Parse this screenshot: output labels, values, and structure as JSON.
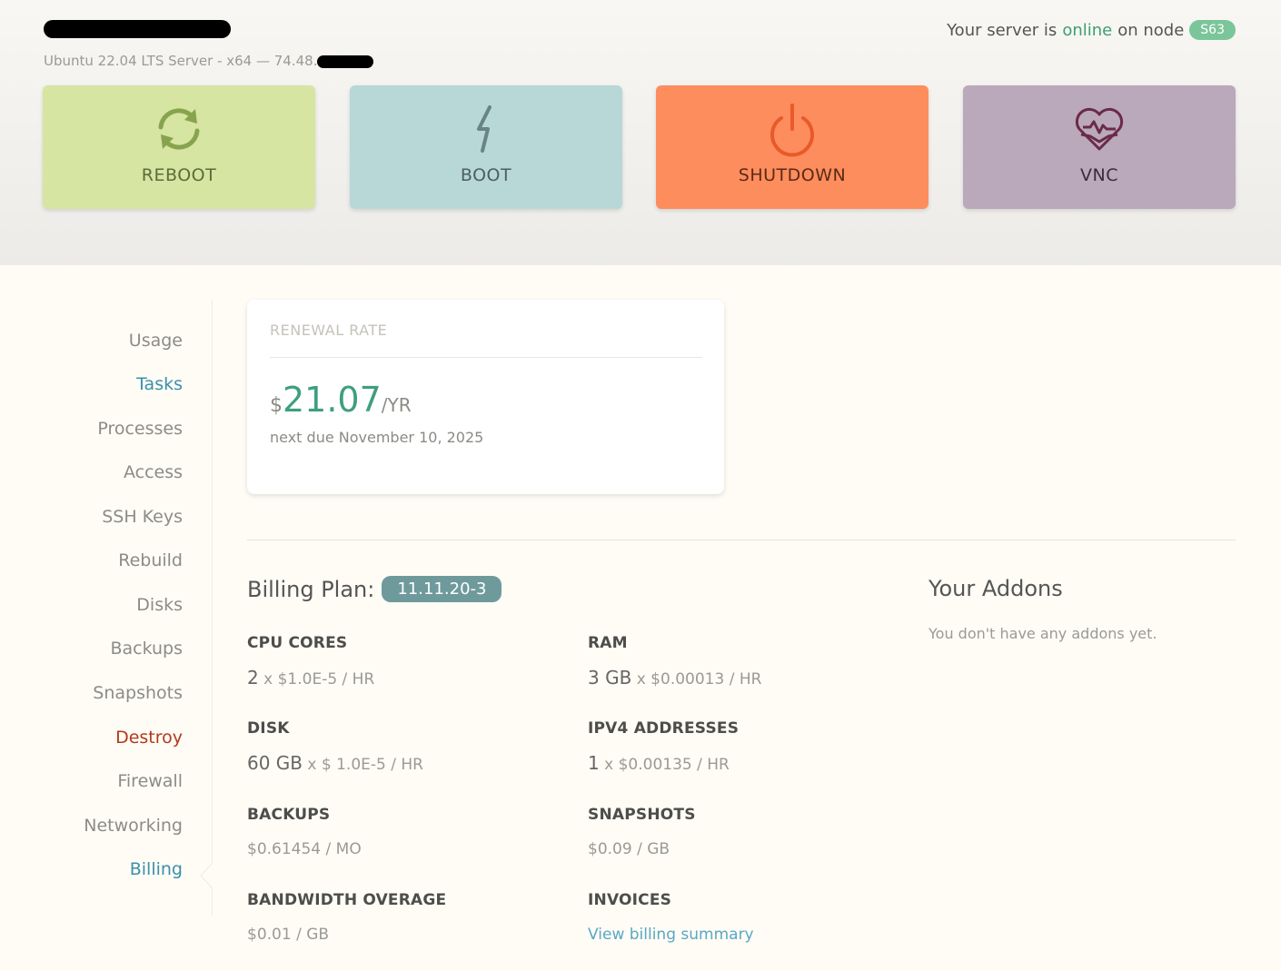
{
  "header": {
    "os_line": "Ubuntu 22.04 LTS Server - x64 — 74.48.",
    "status_prefix": "Your server is",
    "status_state": "online",
    "status_suffix": "on node",
    "node": "S63"
  },
  "actions": {
    "reboot": "REBOOT",
    "boot": "BOOT",
    "shutdown": "SHUTDOWN",
    "vnc": "VNC"
  },
  "sidebar": {
    "items": [
      "Usage",
      "Tasks",
      "Processes",
      "Access",
      "SSH Keys",
      "Rebuild",
      "Disks",
      "Backups",
      "Snapshots",
      "Destroy",
      "Firewall",
      "Networking",
      "Billing"
    ]
  },
  "renewal": {
    "title": "RENEWAL RATE",
    "currency": "$",
    "amount": "21.07",
    "period": "/YR",
    "next_due": "next due November 10, 2025"
  },
  "plan": {
    "label": "Billing Plan:",
    "id": "11.11.20-3"
  },
  "specs": {
    "cpu": {
      "label": "CPU CORES",
      "qty": "2",
      "rate": " x $1.0E-5 / HR"
    },
    "ram": {
      "label": "RAM",
      "qty": "3 GB",
      "rate": " x $0.00013 / HR"
    },
    "disk": {
      "label": "DISK",
      "qty": "60 GB",
      "rate": " x $ 1.0E-5 / HR"
    },
    "ipv4": {
      "label": "IPV4 ADDRESSES",
      "qty": "1",
      "rate": " x $0.00135 / HR"
    },
    "backups": {
      "label": "BACKUPS",
      "value": "$0.61454 / MO"
    },
    "snapshots": {
      "label": "SNAPSHOTS",
      "value": "$0.09 / GB"
    },
    "bandwidth": {
      "label": "BANDWIDTH OVERAGE",
      "value": "$0.01 / GB"
    },
    "invoices": {
      "label": "INVOICES",
      "link": "View billing summary"
    }
  },
  "addons": {
    "title": "Your Addons",
    "empty": "You don't have any addons yet."
  },
  "colors": {
    "online": "#3f9e72",
    "reboot_bg": "#d6e5a1",
    "boot_bg": "#b7d8d7",
    "shutdown_bg": "#fe8d5d",
    "vnc_bg": "#b9a9bb",
    "accent_link": "#3b8fad",
    "destroy": "#b2381b"
  }
}
